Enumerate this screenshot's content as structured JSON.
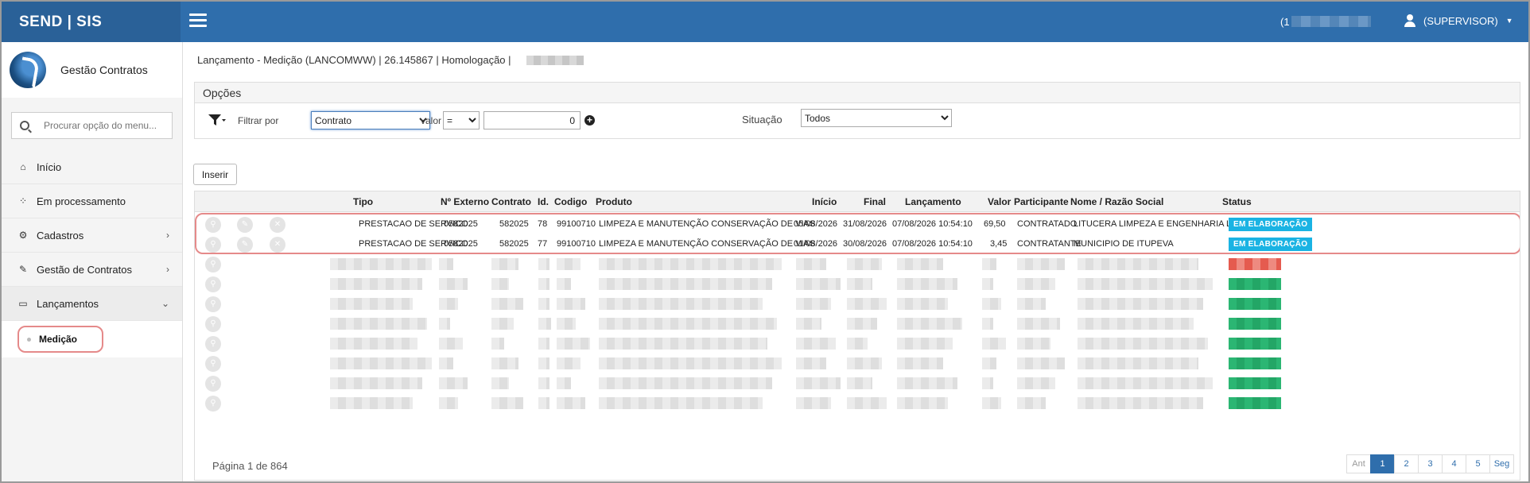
{
  "app": {
    "brand": "SEND | SIS",
    "user_code": "(1",
    "user": "(SUPERVISOR)"
  },
  "sidebar": {
    "app_name": "Gestão Contratos",
    "search_placeholder": "Procurar opção do menu...",
    "items": [
      {
        "label": "Início",
        "icon": "home-icon"
      },
      {
        "label": "Em processamento",
        "icon": "spinner-icon"
      },
      {
        "label": "Cadastros",
        "icon": "gears-icon"
      },
      {
        "label": "Gestão de Contratos",
        "icon": "edit-icon"
      },
      {
        "label": "Lançamentos",
        "icon": "laptop-icon"
      }
    ],
    "sub_item": "Medição"
  },
  "breadcrumb": "Lançamento - Medição (LANCOMWW) | 26.145867 | Homologação |",
  "options": {
    "title": "Opções",
    "filter_label": "Filtrar por",
    "filter_value": "Contrato",
    "valor_label": "valor",
    "operator": "=",
    "valor": "0",
    "situacao_label": "Situação",
    "situacao_value": "Todos"
  },
  "insert_button": "Inserir",
  "table": {
    "headers": [
      "Tipo",
      "Nº Externo",
      "Contrato",
      "Id.",
      "Codigo",
      "Produto",
      "Início",
      "Final",
      "Lançamento",
      "Valor",
      "Participante",
      "Nome / Razão Social",
      "Status"
    ],
    "rows": [
      [
        "PRESTACAO DE SERVICO",
        "0582025",
        "582025",
        "78",
        "99100710",
        "LIMPEZA E MANUTENÇÃO CONSERVAÇÃO DE VIAS",
        "05/08/2026",
        "31/08/2026",
        "07/08/2026 10:54:10",
        "69,50",
        "CONTRATADO",
        "LITUCERA LIMPEZA E ENGENHARIA LTDA",
        "EM ELABORAÇÃO"
      ],
      [
        "PRESTACAO DE SERVICO",
        "0582025",
        "582025",
        "77",
        "99100710",
        "LIMPEZA E MANUTENÇÃO CONSERVAÇÃO DE VIAS",
        "01/08/2026",
        "30/08/2026",
        "07/08/2026 10:54:10",
        "3,45",
        "CONTRATANTE",
        "MUNICIPIO DE ITUPEVA",
        "EM ELABORAÇÃO"
      ]
    ],
    "status_color": "#1ab3e3"
  },
  "pagination": {
    "info": "Página 1 de 864",
    "prev": "Ant",
    "pages": [
      "1",
      "2",
      "3",
      "4",
      "5"
    ],
    "next": "Seg",
    "current": "1"
  },
  "colors": {
    "topbar": "#2f6eac",
    "highlight": "#e58a8a"
  }
}
